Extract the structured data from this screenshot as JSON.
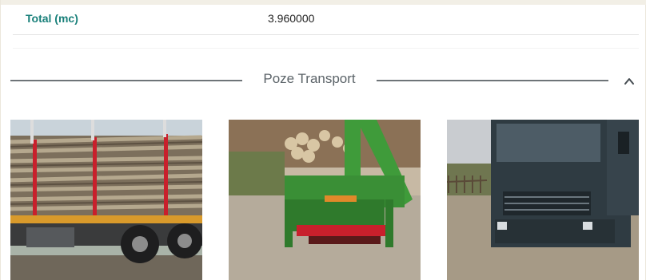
{
  "summary": {
    "total_label": "Total (mc)",
    "total_value": "3.960000"
  },
  "section": {
    "title": "Poze Transport",
    "collapse_icon": "chevron-up-icon",
    "expanded": true
  },
  "photos": [
    {
      "icon": "timber-truck-photo"
    },
    {
      "icon": "forestry-crane-photo"
    },
    {
      "icon": "truck-front-photo"
    }
  ],
  "colors": {
    "accent": "#19807a",
    "title": "#5b6368",
    "divider": "#6e7478"
  }
}
